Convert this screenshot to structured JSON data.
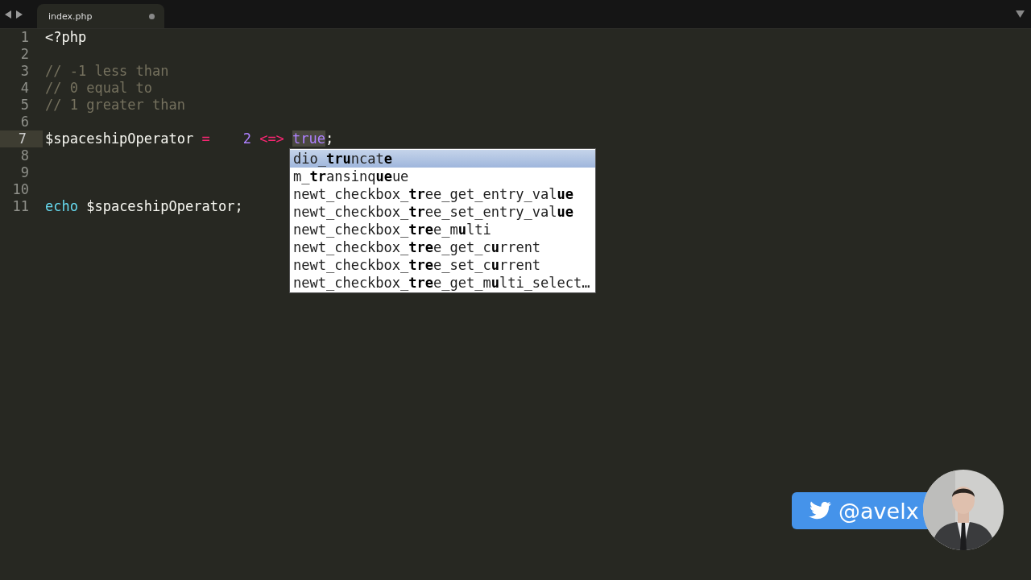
{
  "tabs": [
    {
      "title": "index.php",
      "selected": true,
      "modified": true
    }
  ],
  "editor": {
    "lines": [
      {
        "number": "1",
        "current": false,
        "tokens": [
          {
            "text": "<?php",
            "kind": "plain"
          }
        ]
      },
      {
        "number": "2",
        "current": false
      },
      {
        "number": "3",
        "current": false,
        "tokens": [
          {
            "text": "// -1 less than",
            "kind": "comment"
          }
        ]
      },
      {
        "number": "4",
        "current": false,
        "tokens": [
          {
            "text": "// 0 equal to",
            "kind": "comment"
          }
        ]
      },
      {
        "number": "5",
        "current": false,
        "tokens": [
          {
            "text": "// 1 greater than",
            "kind": "comment"
          }
        ]
      },
      {
        "number": "6",
        "current": false
      },
      {
        "number": "7",
        "current": true,
        "tokens": [
          {
            "text": "$spaceshipOperator ",
            "kind": "plain"
          },
          {
            "text": "=",
            "kind": "operator"
          },
          {
            "text": "    2 ",
            "kind": "number"
          },
          {
            "text": "<=> ",
            "kind": "operator"
          },
          {
            "kind": "caret"
          },
          {
            "text": "true",
            "kind": "highlighted"
          },
          {
            "text": ";",
            "kind": "plain"
          }
        ]
      },
      {
        "number": "8",
        "current": false
      },
      {
        "number": "9",
        "current": false
      },
      {
        "number": "10",
        "current": false
      },
      {
        "number": "11",
        "current": false,
        "tokens": [
          {
            "text": "echo",
            "kind": "keyword"
          },
          {
            "text": " $spaceshipOperator;",
            "kind": "plain"
          }
        ]
      }
    ]
  },
  "autocomplete": [
    {
      "text": "dio_**tru**ncat**e**",
      "selected": true
    },
    {
      "text": "m_**tr**ansinq**ue**ue",
      "selected": false
    },
    {
      "text": "newt_checkbox_**tr**ee_get_entry_val**ue**",
      "selected": false
    },
    {
      "text": "newt_checkbox_**tr**ee_set_entry_val**ue**",
      "selected": false
    },
    {
      "text": "newt_checkbox_**tre**e_m**u**lti",
      "selected": false
    },
    {
      "text": "newt_checkbox_**tre**e_get_c**u**rrent",
      "selected": false
    },
    {
      "text": "newt_checkbox_**tre**e_set_c**u**rrent",
      "selected": false
    },
    {
      "text": "newt_checkbox_**tre**e_get_m**u**lti_select…",
      "selected": false
    }
  ],
  "overlay": {
    "handle": "@avelx"
  }
}
